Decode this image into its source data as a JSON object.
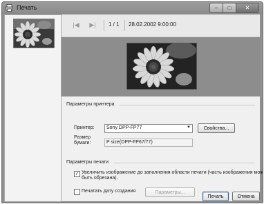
{
  "window": {
    "title": "Печать",
    "buttons": {
      "minimize": "–",
      "maximize": "□",
      "close": "✕"
    }
  },
  "sidebar": {
    "thumbnail": "sunflower"
  },
  "navbar": {
    "first_icon": "|◀",
    "prev_icon": "▶|",
    "page_counter": "1 / 1",
    "timestamp": "28.02.2002 9:00:00"
  },
  "printer_section": {
    "title": "Параметры принтера",
    "printer_label": "Принтер:",
    "printer_value": "Sony DPP-FP77",
    "properties_button": "Свойства...",
    "paper_size_label_line1": "Размер",
    "paper_size_label_line2": "бумаги:",
    "paper_size_value": "P size(DPP-FP67/77)"
  },
  "print_section": {
    "title": "Параметры печати",
    "enlarge_checked": true,
    "enlarge_label_line1": "Увеличить изображение до заполнения области печати (часть изображения может",
    "enlarge_label_line2": "быть обрезана).",
    "print_date_checked": false,
    "print_date_label": "Печатать дату создания",
    "parameters_button": "Параметры..."
  },
  "footer": {
    "print_button": "Печать",
    "cancel_button": "Отмена"
  },
  "colors": {
    "accent": "#3b5f86",
    "preview_background": "#8d8d8d",
    "window_frame": "#8f8f8f"
  }
}
